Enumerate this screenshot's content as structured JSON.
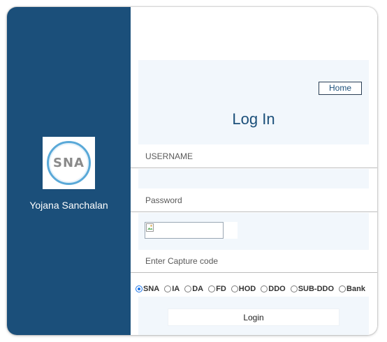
{
  "app": {
    "name": "Yojana Sanchalan",
    "logo_text": "SNA"
  },
  "header": {
    "home_label": "Home",
    "title": "Log In"
  },
  "form": {
    "username_placeholder": "USERNAME",
    "password_placeholder": "Password",
    "captcha_placeholder": "Enter Capture code"
  },
  "roles": {
    "selected": "SNA",
    "options": [
      "SNA",
      "IA",
      "DA",
      "FD",
      "HOD",
      "DDO",
      "SUB-DDO",
      "Bank"
    ]
  },
  "login_label": "Login",
  "colors": {
    "panel": "#1b4f7a",
    "accent": "#1b4f7a",
    "light_bg": "#f2f7fc"
  },
  "icons": {
    "captcha": "broken-image-icon"
  }
}
